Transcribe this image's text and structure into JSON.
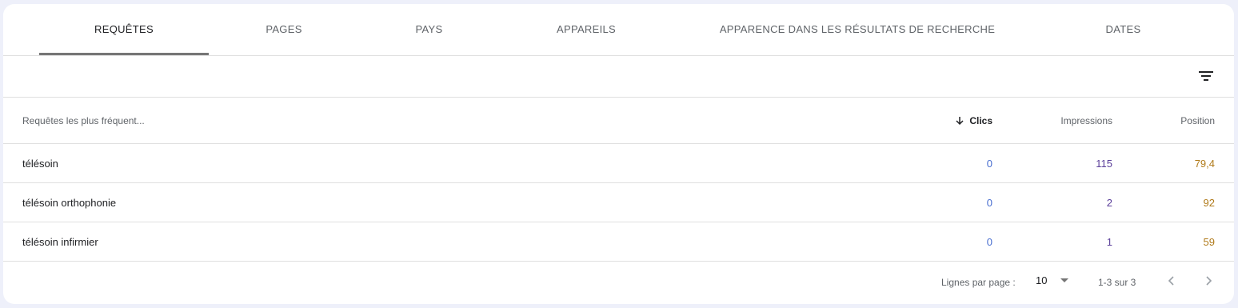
{
  "tabs": [
    {
      "label": "REQUÊTES",
      "active": true
    },
    {
      "label": "PAGES",
      "active": false
    },
    {
      "label": "PAYS",
      "active": false
    },
    {
      "label": "APPAREILS",
      "active": false
    },
    {
      "label": "APPARENCE DANS LES RÉSULTATS DE RECHERCHE",
      "active": false
    },
    {
      "label": "DATES",
      "active": false
    }
  ],
  "filter": {
    "icon": "filter-icon"
  },
  "table": {
    "headers": {
      "query": "Requêtes les plus fréquent...",
      "clicks": "Clics",
      "impressions": "Impressions",
      "position": "Position"
    },
    "sort_icon": "arrow-down-icon",
    "rows": [
      {
        "query": "télésoin",
        "clicks": "0",
        "impressions": "115",
        "position": "79,4"
      },
      {
        "query": "télésoin orthophonie",
        "clicks": "0",
        "impressions": "2",
        "position": "92"
      },
      {
        "query": "télésoin infirmier",
        "clicks": "0",
        "impressions": "1",
        "position": "59"
      }
    ]
  },
  "pagination": {
    "rows_per_page_label": "Lignes par page :",
    "rows_per_page_value": "10",
    "range": "1-3 sur 3"
  },
  "colors": {
    "accent_indicator": "#767676",
    "clicks": "#4a6fd0",
    "impressions": "#5b3f9a",
    "position": "#b07a1a"
  }
}
